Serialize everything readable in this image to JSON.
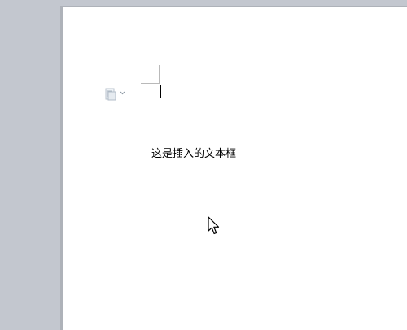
{
  "document": {
    "text_box": {
      "text": "这是插入的文本框"
    }
  },
  "icons": {
    "paste_options": "paste-options-icon",
    "dropdown": "chevron-down-icon",
    "mouse_pointer": "mouse-pointer-icon"
  },
  "colors": {
    "workspace": "#c3c7cf",
    "page": "#ffffff",
    "text": "#000000"
  }
}
